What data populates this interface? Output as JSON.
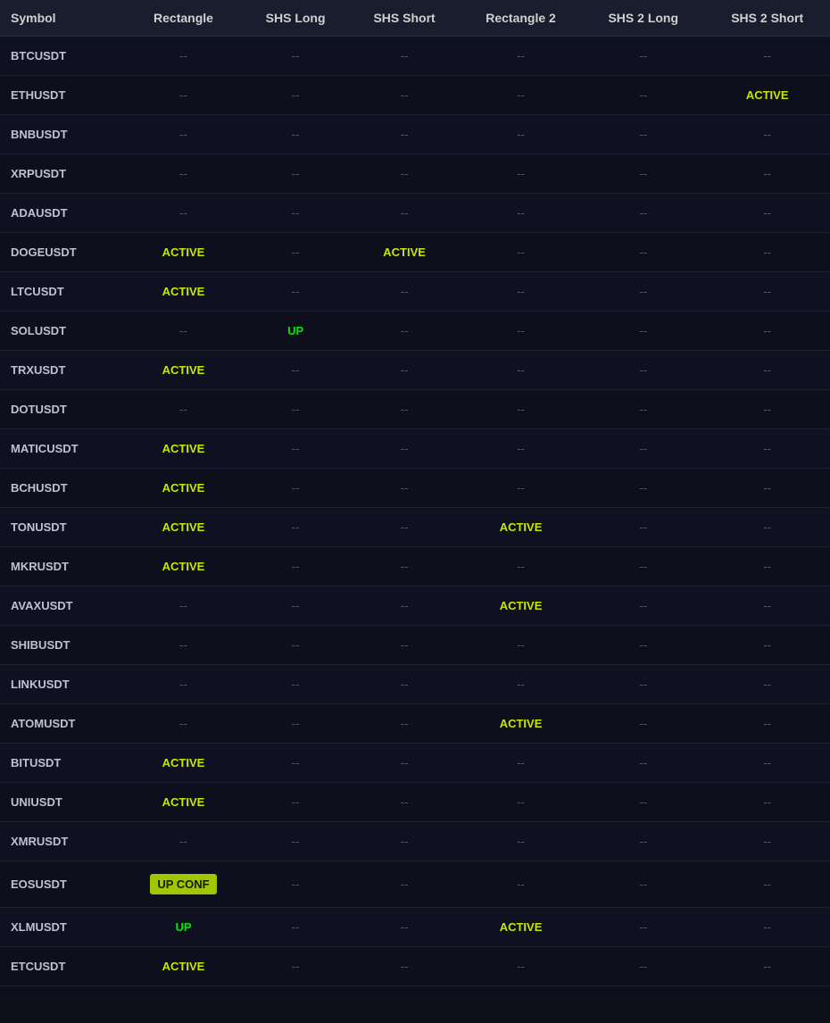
{
  "table": {
    "columns": [
      {
        "key": "symbol",
        "label": "Symbol"
      },
      {
        "key": "rectangle",
        "label": "Rectangle"
      },
      {
        "key": "shs_long",
        "label": "SHS Long"
      },
      {
        "key": "shs_short",
        "label": "SHS Short"
      },
      {
        "key": "rectangle2",
        "label": "Rectangle 2"
      },
      {
        "key": "shs2_long",
        "label": "SHS 2 Long"
      },
      {
        "key": "shs2_short",
        "label": "SHS 2 Short"
      }
    ],
    "rows": [
      {
        "symbol": "BTCUSDT",
        "rectangle": "--",
        "shs_long": "--",
        "shs_short": "--",
        "rectangle2": "--",
        "shs2_long": "--",
        "shs2_short": "--"
      },
      {
        "symbol": "ETHUSDT",
        "rectangle": "--",
        "shs_long": "--",
        "shs_short": "--",
        "rectangle2": "--",
        "shs2_long": "--",
        "shs2_short": "ACTIVE"
      },
      {
        "symbol": "BNBUSDT",
        "rectangle": "--",
        "shs_long": "--",
        "shs_short": "--",
        "rectangle2": "--",
        "shs2_long": "--",
        "shs2_short": "--"
      },
      {
        "symbol": "XRPUSDT",
        "rectangle": "--",
        "shs_long": "--",
        "shs_short": "--",
        "rectangle2": "--",
        "shs2_long": "--",
        "shs2_short": "--"
      },
      {
        "symbol": "ADAUSDT",
        "rectangle": "--",
        "shs_long": "--",
        "shs_short": "--",
        "rectangle2": "--",
        "shs2_long": "--",
        "shs2_short": "--"
      },
      {
        "symbol": "DOGEUSDT",
        "rectangle": "ACTIVE",
        "shs_long": "--",
        "shs_short": "ACTIVE",
        "rectangle2": "--",
        "shs2_long": "--",
        "shs2_short": "--"
      },
      {
        "symbol": "LTCUSDT",
        "rectangle": "ACTIVE",
        "shs_long": "--",
        "shs_short": "--",
        "rectangle2": "--",
        "shs2_long": "--",
        "shs2_short": "--"
      },
      {
        "symbol": "SOLUSDT",
        "rectangle": "--",
        "shs_long": "UP",
        "shs_short": "--",
        "rectangle2": "--",
        "shs2_long": "--",
        "shs2_short": "--"
      },
      {
        "symbol": "TRXUSDT",
        "rectangle": "ACTIVE",
        "shs_long": "--",
        "shs_short": "--",
        "rectangle2": "--",
        "shs2_long": "--",
        "shs2_short": "--"
      },
      {
        "symbol": "DOTUSDT",
        "rectangle": "--",
        "shs_long": "--",
        "shs_short": "--",
        "rectangle2": "--",
        "shs2_long": "--",
        "shs2_short": "--"
      },
      {
        "symbol": "MATICUSDT",
        "rectangle": "ACTIVE",
        "shs_long": "--",
        "shs_short": "--",
        "rectangle2": "--",
        "shs2_long": "--",
        "shs2_short": "--"
      },
      {
        "symbol": "BCHUSDT",
        "rectangle": "ACTIVE",
        "shs_long": "--",
        "shs_short": "--",
        "rectangle2": "--",
        "shs2_long": "--",
        "shs2_short": "--"
      },
      {
        "symbol": "TONUSDT",
        "rectangle": "ACTIVE",
        "shs_long": "--",
        "shs_short": "--",
        "rectangle2": "ACTIVE",
        "shs2_long": "--",
        "shs2_short": "--"
      },
      {
        "symbol": "MKRUSDT",
        "rectangle": "ACTIVE",
        "shs_long": "--",
        "shs_short": "--",
        "rectangle2": "--",
        "shs2_long": "--",
        "shs2_short": "--"
      },
      {
        "symbol": "AVAXUSDT",
        "rectangle": "--",
        "shs_long": "--",
        "shs_short": "--",
        "rectangle2": "ACTIVE",
        "shs2_long": "--",
        "shs2_short": "--"
      },
      {
        "symbol": "SHIBUSDT",
        "rectangle": "--",
        "shs_long": "--",
        "shs_short": "--",
        "rectangle2": "--",
        "shs2_long": "--",
        "shs2_short": "--"
      },
      {
        "symbol": "LINKUSDT",
        "rectangle": "--",
        "shs_long": "--",
        "shs_short": "--",
        "rectangle2": "--",
        "shs2_long": "--",
        "shs2_short": "--"
      },
      {
        "symbol": "ATOMUSDT",
        "rectangle": "--",
        "shs_long": "--",
        "shs_short": "--",
        "rectangle2": "ACTIVE",
        "shs2_long": "--",
        "shs2_short": "--"
      },
      {
        "symbol": "BITUSDT",
        "rectangle": "ACTIVE",
        "shs_long": "--",
        "shs_short": "--",
        "rectangle2": "--",
        "shs2_long": "--",
        "shs2_short": "--"
      },
      {
        "symbol": "UNIUSDT",
        "rectangle": "ACTIVE",
        "shs_long": "--",
        "shs_short": "--",
        "rectangle2": "--",
        "shs2_long": "--",
        "shs2_short": "--"
      },
      {
        "symbol": "XMRUSDT",
        "rectangle": "--",
        "shs_long": "--",
        "shs_short": "--",
        "rectangle2": "--",
        "shs2_long": "--",
        "shs2_short": "--"
      },
      {
        "symbol": "EOSUSDT",
        "rectangle": "UP CONF",
        "shs_long": "--",
        "shs_short": "--",
        "rectangle2": "--",
        "shs2_long": "--",
        "shs2_short": "--"
      },
      {
        "symbol": "XLMUSDT",
        "rectangle": "UP",
        "shs_long": "--",
        "shs_short": "--",
        "rectangle2": "ACTIVE",
        "shs2_long": "--",
        "shs2_short": "--"
      },
      {
        "symbol": "ETCUSDT",
        "rectangle": "ACTIVE",
        "shs_long": "--",
        "shs_short": "--",
        "rectangle2": "--",
        "shs2_long": "--",
        "shs2_short": "--"
      }
    ]
  }
}
